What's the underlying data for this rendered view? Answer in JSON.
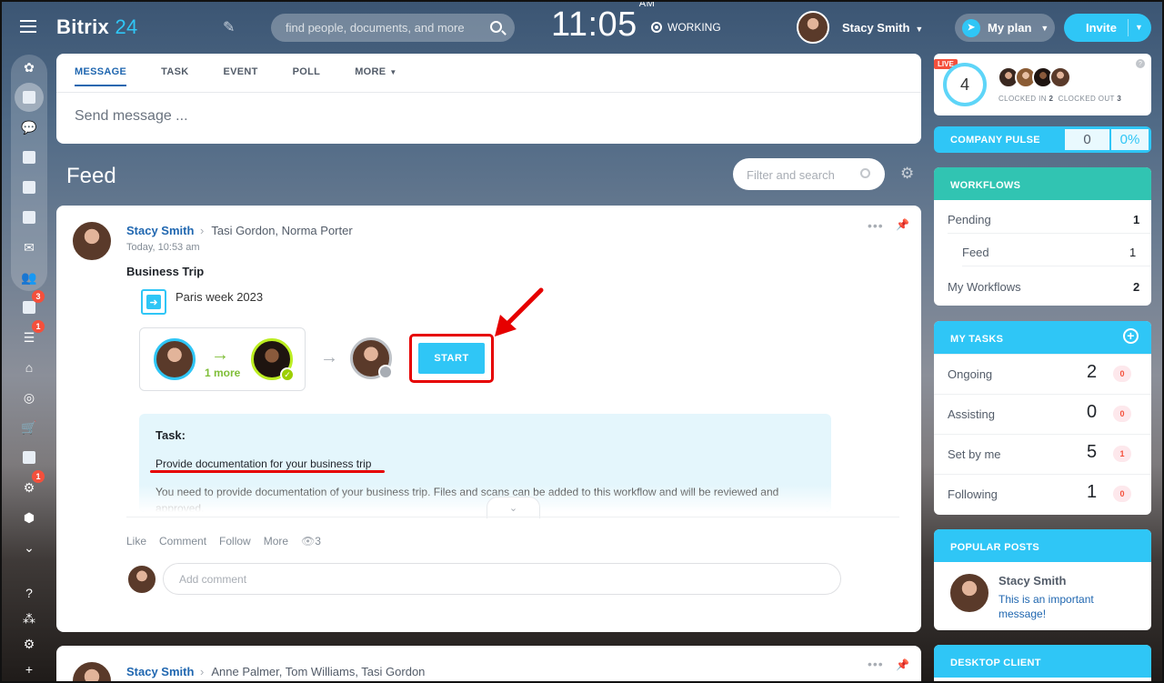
{
  "header": {
    "logo_main": "Bitrix",
    "logo_num": "24",
    "search_placeholder": "find people, documents, and more",
    "time": "11:05",
    "ampm": "AM",
    "working": "WORKING",
    "user_name": "Stacy Smith",
    "myplan": "My plan",
    "invite": "Invite"
  },
  "sidebar": {
    "badges": {
      "tasks": "3",
      "crm": "1",
      "robots": "1"
    }
  },
  "composer": {
    "tabs": [
      {
        "label": "MESSAGE"
      },
      {
        "label": "TASK"
      },
      {
        "label": "EVENT"
      },
      {
        "label": "POLL"
      },
      {
        "label": "MORE"
      }
    ],
    "placeholder": "Send message ..."
  },
  "feed": {
    "title": "Feed",
    "filter_placeholder": "Filter and search"
  },
  "post": {
    "author": "Stacy Smith",
    "recipients": "Tasi Gordon, Norma Porter",
    "time": "Today, 10:53 am",
    "title": "Business Trip",
    "workflow_name": "Paris week 2023",
    "more_label": "1 more",
    "start_label": "START",
    "task_label": "Task:",
    "task_title": "Provide documentation for your business trip",
    "task_desc": "You need to provide documentation of your business trip. Files and scans can be added to this workflow and will be reviewed and approved.",
    "actions": {
      "like": "Like",
      "comment": "Comment",
      "follow": "Follow",
      "more": "More",
      "views": "3"
    },
    "comment_placeholder": "Add comment"
  },
  "post2": {
    "author": "Stacy Smith",
    "recipients": "Anne Palmer, Tom Williams, Tasi Gordon"
  },
  "live": {
    "badge": "LIVE",
    "count": "4",
    "clocked_in_label": "CLOCKED IN",
    "clocked_in": "2",
    "clocked_out_label": "CLOCKED OUT",
    "clocked_out": "3"
  },
  "pulse": {
    "label": "COMPANY PULSE",
    "value": "0",
    "percent": "0%"
  },
  "workflows": {
    "title": "WORKFLOWS",
    "rows": [
      {
        "label": "Pending",
        "value": "1"
      },
      {
        "label": "Feed",
        "value": "1"
      },
      {
        "label": "My Workflows",
        "value": "2"
      }
    ]
  },
  "tasks": {
    "title": "MY TASKS",
    "rows": [
      {
        "label": "Ongoing",
        "count": "2",
        "badge": "0"
      },
      {
        "label": "Assisting",
        "count": "0",
        "badge": "0"
      },
      {
        "label": "Set by me",
        "count": "5",
        "badge": "1"
      },
      {
        "label": "Following",
        "count": "1",
        "badge": "0"
      }
    ]
  },
  "popular": {
    "title": "POPULAR POSTS",
    "author": "Stacy Smith",
    "message": "This is an important message!"
  },
  "desktop": {
    "title": "DESKTOP CLIENT"
  },
  "colors": {
    "accent": "#2fc6f6",
    "link": "#2067b0",
    "highlight": "#e60000",
    "workflow_green": "#31c4b2"
  }
}
